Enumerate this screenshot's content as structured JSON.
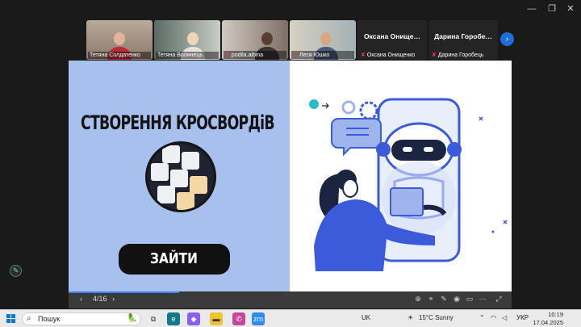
{
  "window": {
    "minimize_glyph": "—",
    "maximize_glyph": "❐",
    "close_glyph": "✕"
  },
  "participants": [
    {
      "name": "Тетяна Солдатенко",
      "muted": false,
      "type": "video"
    },
    {
      "name": "Тетяна Волинець",
      "muted": false,
      "type": "video",
      "active": true
    },
    {
      "name": "podila.aibina",
      "muted": true,
      "type": "video"
    },
    {
      "name": "Леся Юшко",
      "muted": true,
      "type": "video"
    },
    {
      "name": "Оксана Онищенко",
      "display": "Оксана  Онище…",
      "muted": true,
      "type": "text"
    },
    {
      "name": "Дарина Горобець",
      "display": "Дарина  Горобе…",
      "muted": true,
      "type": "text"
    }
  ],
  "slide": {
    "title": "СТВОРЕННЯ КРОСВОРДіВ",
    "button_label": "ЗАЙТИ",
    "page_indicator": "4/16",
    "progress_fraction": 0.25,
    "colors": {
      "left_bg": "#a7c0ee",
      "accent": "#3b5bdb"
    }
  },
  "taskbar": {
    "search_placeholder": "Пошук",
    "language_layout": "UK",
    "weather": "15°C  Sunny",
    "input_language": "УКР",
    "time": "10:19",
    "date": "17.04.2025"
  }
}
